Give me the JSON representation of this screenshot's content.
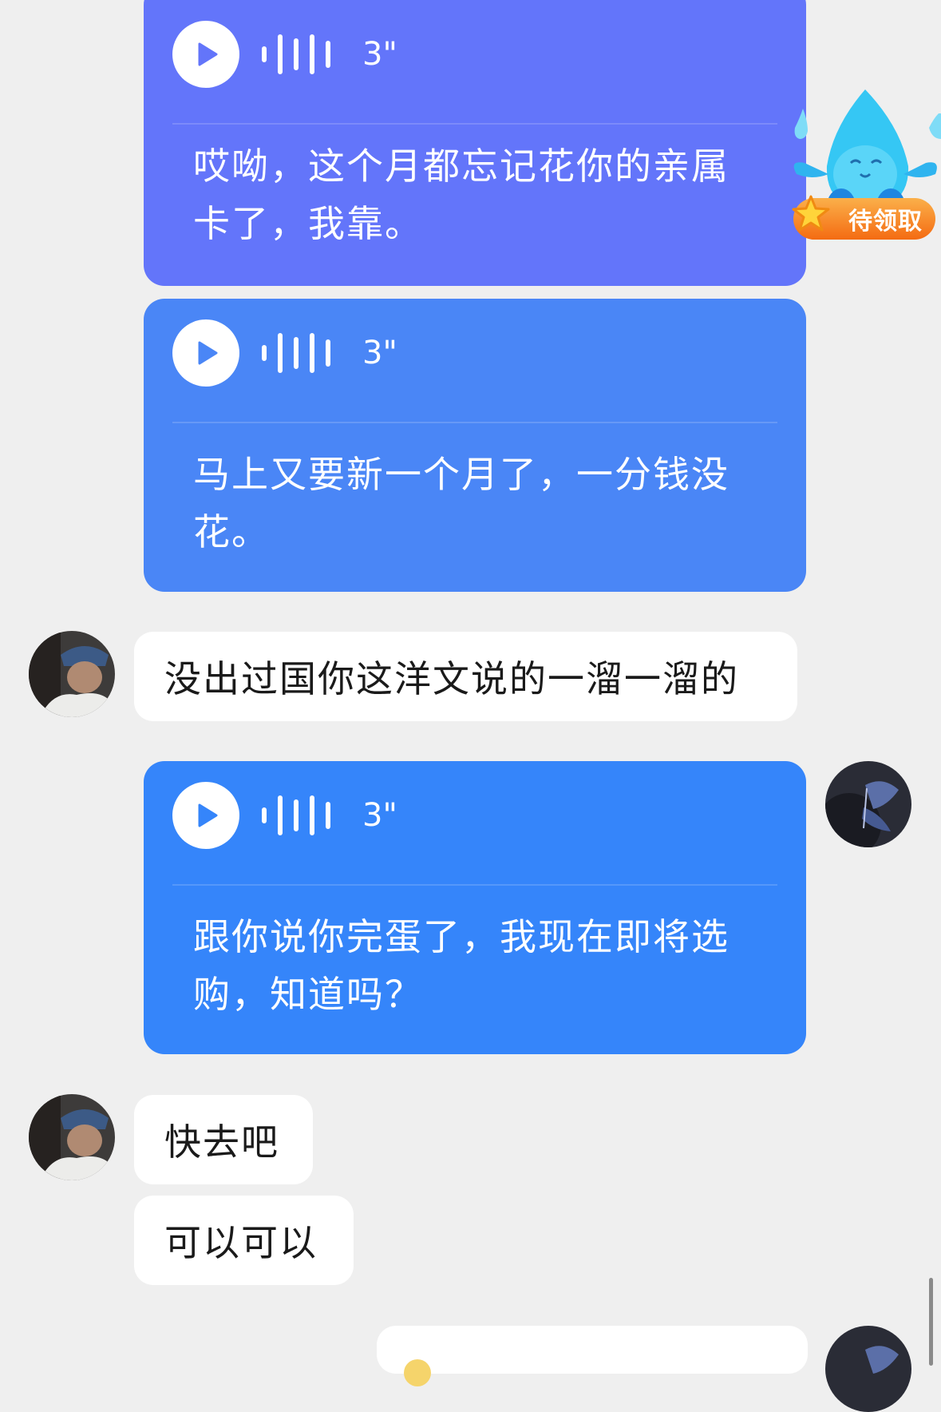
{
  "colors": {
    "background": "#efefef",
    "voice_bubble_1": "#6375fa",
    "voice_bubble_2": "#4a86f6",
    "voice_bubble_3": "#3585fa",
    "incoming_bubble": "#ffffff",
    "badge_orange": "#f97a1e"
  },
  "messages": [
    {
      "type": "voice",
      "direction": "outgoing",
      "duration": "3\"",
      "transcript": "哎呦，这个月都忘记花你的亲属卡了，我靠。"
    },
    {
      "type": "voice",
      "direction": "outgoing",
      "duration": "3\"",
      "transcript": "马上又要新一个月了，一分钱没花。"
    },
    {
      "type": "text",
      "direction": "incoming",
      "text": "没出过国你这洋文说的一溜一溜的"
    },
    {
      "type": "voice",
      "direction": "outgoing",
      "duration": "3\"",
      "transcript": "跟你说你完蛋了，我现在即将选购，知道吗？"
    },
    {
      "type": "text",
      "direction": "incoming",
      "text": "快去吧"
    },
    {
      "type": "text",
      "direction": "incoming",
      "text": "可以可以"
    }
  ],
  "floating_widget": {
    "icon": "water-drop-mascot-icon",
    "badge_label": "待领取"
  }
}
